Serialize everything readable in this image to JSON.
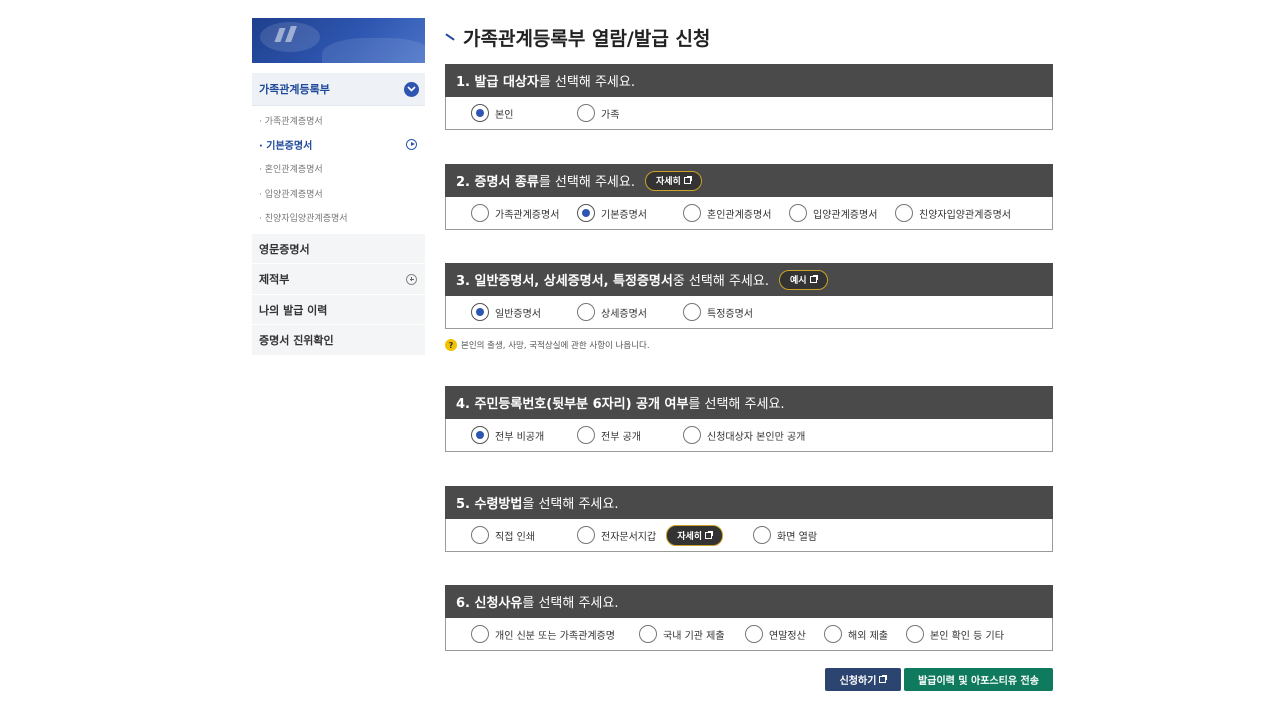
{
  "sidebar": {
    "head_label": "가족관계등록부",
    "sub_items": [
      {
        "label": "가족관계증명서"
      },
      {
        "label": "기본증명서"
      },
      {
        "label": "혼인관계증명서"
      },
      {
        "label": "입양관계증명서"
      },
      {
        "label": "친양자입양관계증명서"
      }
    ],
    "categories": [
      {
        "label": "영문증명서"
      },
      {
        "label": "제적부"
      },
      {
        "label": "나의 발급 이력"
      },
      {
        "label": "증명서 진위확인"
      }
    ]
  },
  "main": {
    "page_title": "가족관계등록부 열람/발급 신청",
    "sections": [
      {
        "head_bold": "1. 발급 대상자",
        "head_rest": "를 선택해 주세요.",
        "options": [
          "본인",
          "가족"
        ],
        "selected": 0
      },
      {
        "head_bold": "2. 증명서 종류",
        "head_rest": "를 선택해 주세요.",
        "head_button": "자세히",
        "options": [
          "가족관계증명서",
          "기본증명서",
          "혼인관계증명서",
          "입양관계증명서",
          "친양자입양관계증명서"
        ],
        "selected": 1
      },
      {
        "head_bold": "3. 일반증명서, 상세증명서, 특정증명서",
        "head_rest": " 중 선택해 주세요.",
        "head_button": "예시",
        "options": [
          "일반증명서",
          "상세증명서",
          "특정증명서"
        ],
        "selected": 0,
        "hint": "본인의 출생, 사망, 국적상실에 관한 사항이 나옵니다."
      },
      {
        "head_bold": "4. 주민등록번호(뒷부분 6자리) 공개 여부",
        "head_rest": "를 선택해 주세요.",
        "options": [
          "전부 비공개",
          "전부 공개",
          "신청대상자 본인만 공개"
        ],
        "selected": 0
      },
      {
        "head_bold": "5. 수령방법",
        "head_rest": "을 선택해 주세요.",
        "options": [
          "직접 인쇄",
          "전자문서지갑",
          "화면 열람"
        ],
        "inline_button": "자세히",
        "selected": null
      },
      {
        "head_bold": "6. 신청사유",
        "head_rest": "를 선택해 주세요.",
        "options": [
          "개인 신분 또는 가족관계증명",
          "국내 기관 제출",
          "연말정산",
          "해외 제출",
          "본인 확인 등 기타"
        ],
        "selected": null
      }
    ],
    "buttons": {
      "apply": "신청하기",
      "send": "발급이력 및 아포스티유 전송"
    }
  }
}
